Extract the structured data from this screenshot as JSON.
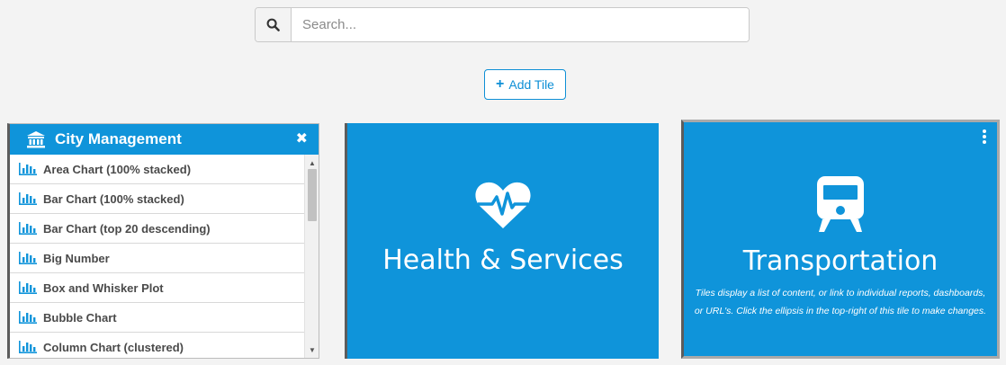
{
  "search": {
    "placeholder": "Search...",
    "value": "",
    "icon": "search-icon"
  },
  "add_tile": {
    "label": "Add Tile",
    "icon": "plus-icon"
  },
  "list_tile": {
    "title": "City Management",
    "icon": "bank-icon",
    "close_icon": "times-icon",
    "close_symbol": "✖",
    "items": [
      {
        "label": "Area Chart (100% stacked)",
        "icon": "bar-chart-icon"
      },
      {
        "label": "Bar Chart (100% stacked)",
        "icon": "bar-chart-icon"
      },
      {
        "label": "Bar Chart (top 20 descending)",
        "icon": "bar-chart-icon"
      },
      {
        "label": "Big Number",
        "icon": "bar-chart-icon"
      },
      {
        "label": "Box and Whisker Plot",
        "icon": "bar-chart-icon"
      },
      {
        "label": "Bubble Chart",
        "icon": "bar-chart-icon"
      },
      {
        "label": "Column Chart (clustered)",
        "icon": "bar-chart-icon"
      }
    ]
  },
  "tiles": {
    "health": {
      "title": "Health & Services",
      "icon": "heartbeat-icon"
    },
    "transport": {
      "title": "Transportation",
      "icon": "train-icon",
      "description": "Tiles display a list of content, or link to individual reports, dashboards, or URL's. Click the ellipsis in the top-right of this tile to make changes."
    }
  },
  "colors": {
    "tile_blue": "#0f94da",
    "accent": "#0e8fd6",
    "page_bg": "#f3f3f3"
  }
}
